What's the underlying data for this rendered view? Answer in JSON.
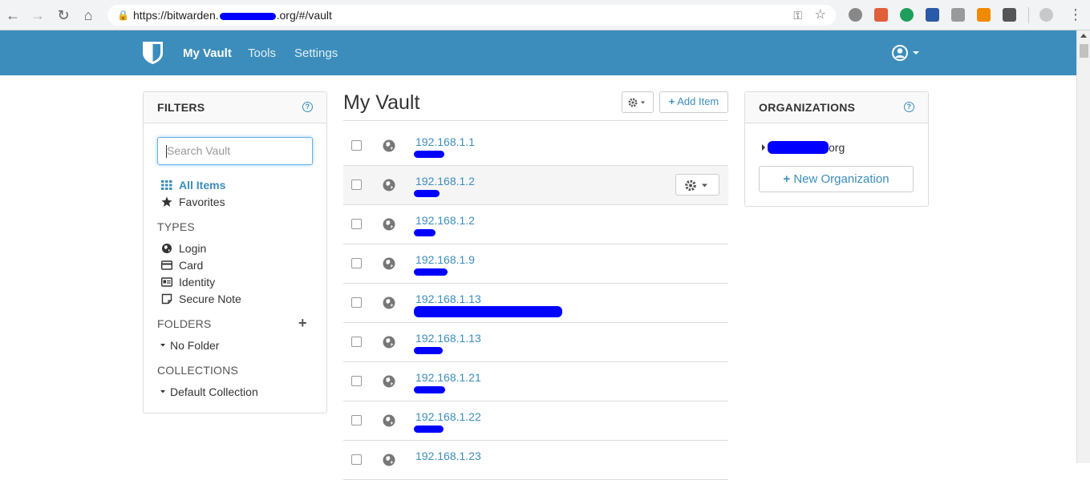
{
  "browser": {
    "url_prefix": "https://bitwarden.",
    "url_suffix": ".org/#/vault"
  },
  "nav": {
    "my_vault": "My Vault",
    "tools": "Tools",
    "settings": "Settings"
  },
  "filters": {
    "title": "FILTERS",
    "help": "?",
    "search_placeholder": "Search Vault",
    "all_items": "All Items",
    "favorites": "Favorites",
    "types_heading": "TYPES",
    "types": [
      "Login",
      "Card",
      "Identity",
      "Secure Note"
    ],
    "folders_heading": "FOLDERS",
    "folders_add": "+",
    "no_folder": "No Folder",
    "collections_heading": "COLLECTIONS",
    "default_collection": "Default Collection"
  },
  "vault": {
    "title": "My Vault",
    "add_item": "Add Item",
    "items": [
      {
        "name": "192.168.1.1"
      },
      {
        "name": "192.168.1.2"
      },
      {
        "name": "192.168.1.2"
      },
      {
        "name": "192.168.1.9"
      },
      {
        "name": "192.168.1.13"
      },
      {
        "name": "192.168.1.13"
      },
      {
        "name": "192.168.1.21"
      },
      {
        "name": "192.168.1.22"
      },
      {
        "name": "192.168.1.23"
      }
    ]
  },
  "organizations": {
    "title": "ORGANIZATIONS",
    "help": "?",
    "org_suffix": "org",
    "new_org": "New Organization"
  },
  "colors": {
    "brand_blue": "#3c8dbc",
    "redaction": "#0000ff"
  }
}
